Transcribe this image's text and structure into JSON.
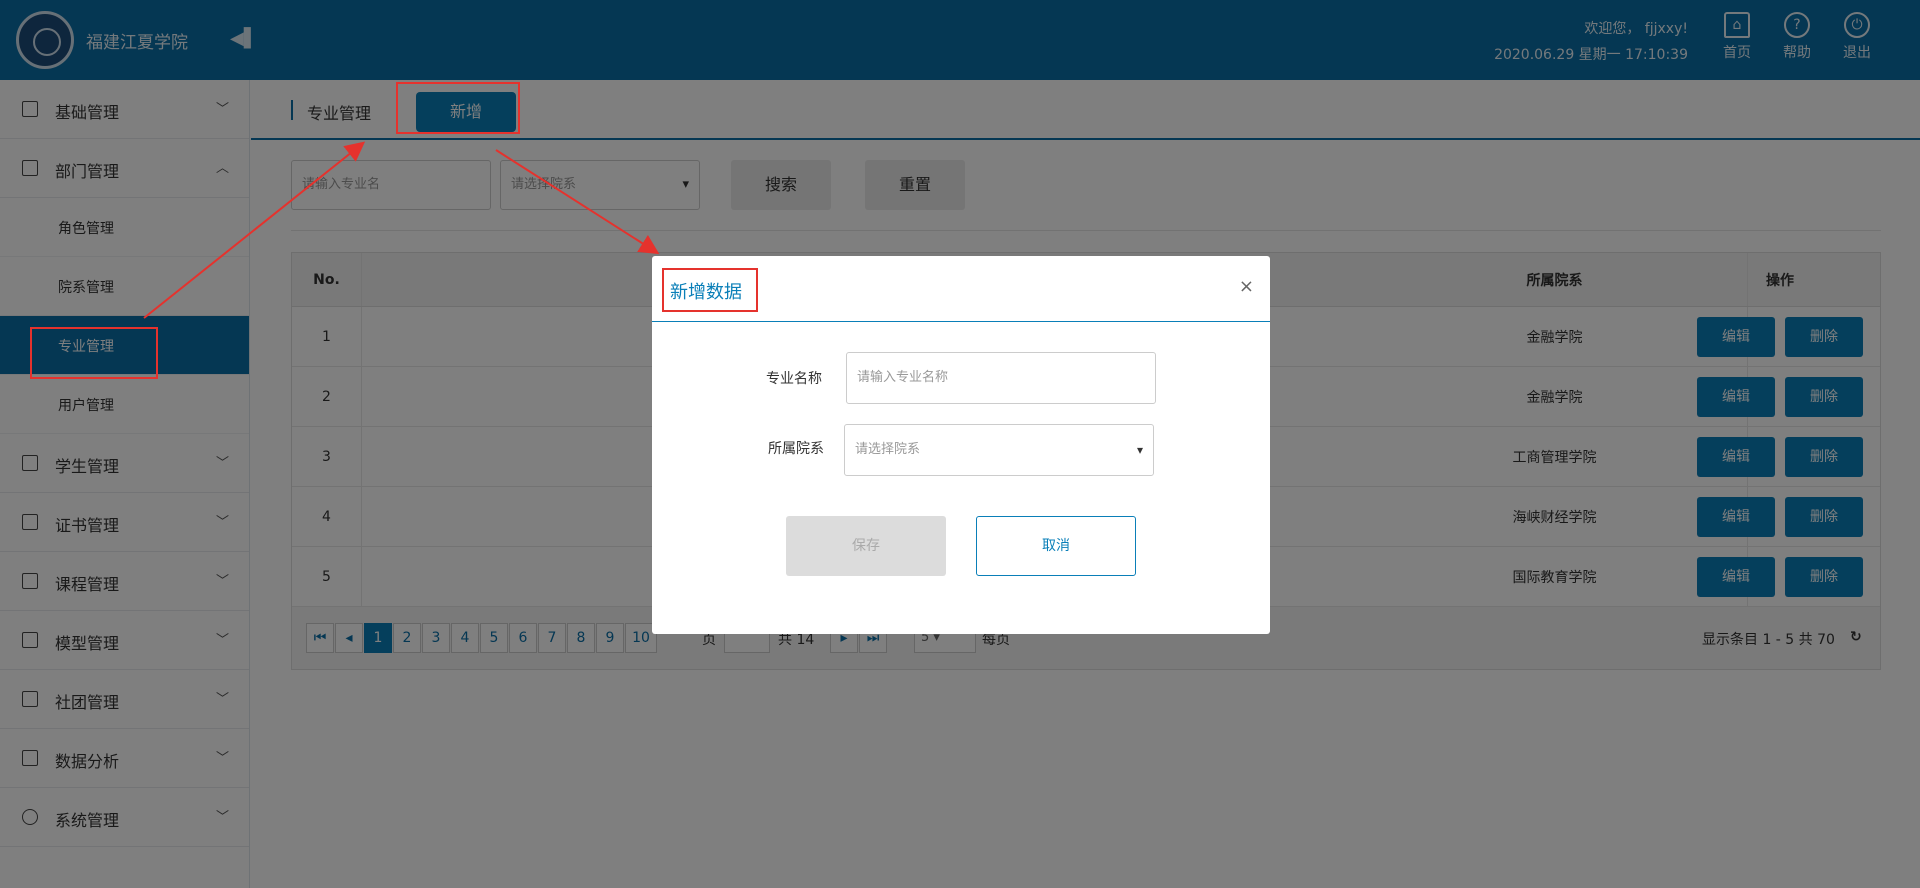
{
  "header": {
    "app_title": "福建江夏学院",
    "welcome": "欢迎您， fjjxxy!",
    "datetime": "2020.06.29 星期一 17:10:39",
    "buttons": [
      {
        "label": "首页",
        "icon": "home-icon"
      },
      {
        "label": "帮助",
        "icon": "help-icon"
      },
      {
        "label": "退出",
        "icon": "power-icon"
      }
    ]
  },
  "sidebar": {
    "menus": [
      {
        "label": "基础管理",
        "icon": "list-icon"
      },
      {
        "label": "部门管理",
        "icon": "building-icon"
      },
      {
        "label": "学生管理",
        "icon": "student-icon"
      },
      {
        "label": "证书管理",
        "icon": "certificate-icon"
      },
      {
        "label": "课程管理",
        "icon": "course-icon"
      },
      {
        "label": "模型管理",
        "icon": "model-icon"
      },
      {
        "label": "社团管理",
        "icon": "club-icon"
      },
      {
        "label": "数据分析",
        "icon": "analysis-icon"
      },
      {
        "label": "系统管理",
        "icon": "settings-icon"
      }
    ],
    "sub_items": [
      "角色管理",
      "院系管理",
      "专业管理",
      "用户管理"
    ],
    "active_sub": "专业管理"
  },
  "tabbar": {
    "tab_label": "专业管理",
    "add_label": "新增"
  },
  "filters": {
    "name_placeholder": "请输入专业名",
    "dept_placeholder": "请选择院系",
    "search_label": "搜索",
    "reset_label": "重置"
  },
  "table": {
    "headers": {
      "no": "No.",
      "dept": "所属院系",
      "op": "操作"
    },
    "rows": [
      {
        "no": "1",
        "dept": "金融学院"
      },
      {
        "no": "2",
        "dept": "金融学院"
      },
      {
        "no": "3",
        "dept": "工商管理学院"
      },
      {
        "no": "4",
        "dept": "海峡财经学院"
      },
      {
        "no": "5",
        "dept": "国际教育学院"
      }
    ],
    "edit_label": "编辑",
    "delete_label": "删除"
  },
  "pager": {
    "pages": [
      "1",
      "2",
      "3",
      "4",
      "5",
      "6",
      "7",
      "8",
      "9",
      "10"
    ],
    "current": "1",
    "page_label": "页",
    "total_pages": "共 14",
    "page_size": "5",
    "per_page_label": "每页",
    "summary": "显示条目 1 - 5 共 70"
  },
  "modal": {
    "title": "新增数据",
    "name_label": "专业名称",
    "name_placeholder": "请输入专业名称",
    "dept_label": "所属院系",
    "dept_placeholder": "请选择院系",
    "save_label": "保存",
    "cancel_label": "取消"
  }
}
